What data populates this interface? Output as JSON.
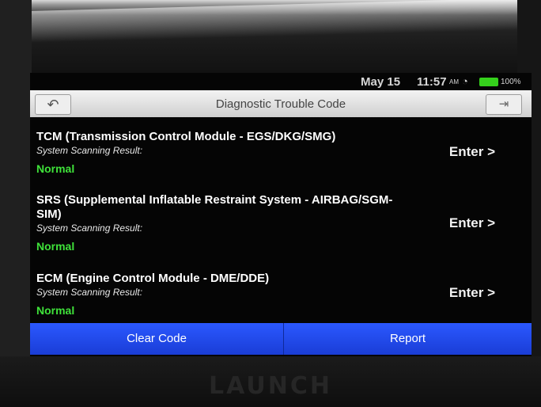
{
  "status": {
    "date": "May 15",
    "time": "11:57",
    "ampm": "AM",
    "battery": "100%"
  },
  "header": {
    "title": "Diagnostic Trouble Code",
    "back_icon": "back-arrow-icon",
    "exit_icon": "exit-icon"
  },
  "modules": [
    {
      "name": "TCM (Transmission Control Module - EGS/DKG/SMG)",
      "label": "System Scanning Result:",
      "result": "Normal",
      "action": "Enter >"
    },
    {
      "name": "SRS (Supplemental Inflatable Restraint System - AIRBAG/SGM-SIM)",
      "label": "System Scanning Result:",
      "result": "Normal",
      "action": "Enter >"
    },
    {
      "name": "ECM (Engine Control Module - DME/DDE)",
      "label": "System Scanning Result:",
      "result": "Normal",
      "action": "Enter >"
    }
  ],
  "footer": {
    "clear_label": "Clear Code",
    "report_label": "Report"
  },
  "brand": "LAUNCH",
  "colors": {
    "result_ok": "#3fe23a",
    "button_bar": "#2b58ff"
  }
}
